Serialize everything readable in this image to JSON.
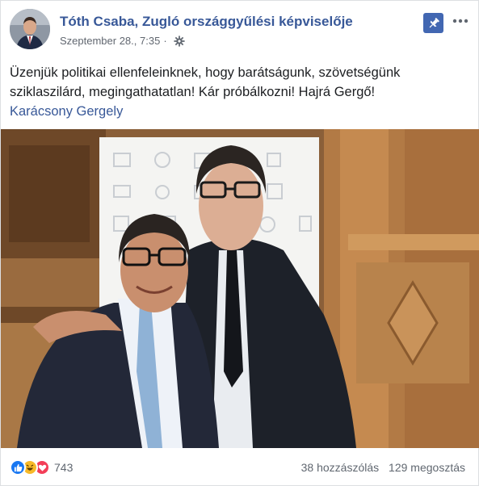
{
  "post": {
    "author": "Tóth Csaba, Zugló országgyűlési képviselője",
    "date": "Szeptember 28., 7:35",
    "separator": "·",
    "text": "Üzenjük politikai ellenfeleinknek, hogy barátságunk, szövetségünk sziklaszilárd, megingathatatlan! Kár próbálkozni! Hajrá Gergő!",
    "mention": "Karácsony Gergely"
  },
  "footer": {
    "reactions_count": "743",
    "comments": "38 hozzászólás",
    "shares": "129 megosztás"
  },
  "colors": {
    "link": "#385898",
    "brand": "#4267b2",
    "text": "#1c1e21",
    "secondary": "#616770"
  },
  "icons": {
    "pin": "pin-icon",
    "more": "more-options-icon",
    "audience": "gear-icon",
    "reactions": [
      "like-icon",
      "haha-icon",
      "love-icon"
    ]
  }
}
